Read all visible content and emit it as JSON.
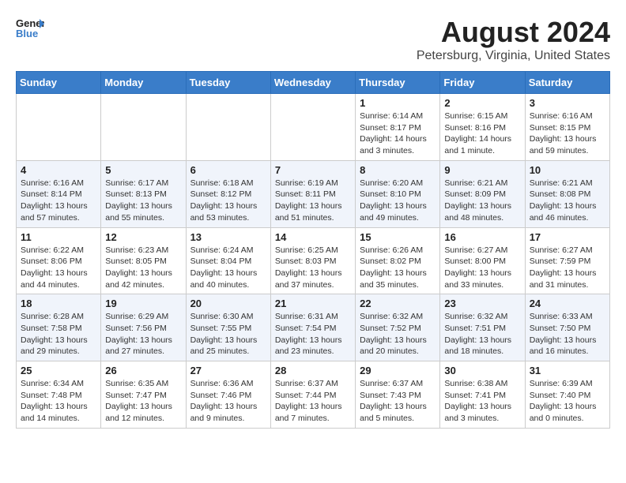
{
  "header": {
    "logo_line1": "General",
    "logo_line2": "Blue",
    "month_title": "August 2024",
    "location": "Petersburg, Virginia, United States"
  },
  "weekdays": [
    "Sunday",
    "Monday",
    "Tuesday",
    "Wednesday",
    "Thursday",
    "Friday",
    "Saturday"
  ],
  "weeks": [
    [
      {
        "day": "",
        "detail": ""
      },
      {
        "day": "",
        "detail": ""
      },
      {
        "day": "",
        "detail": ""
      },
      {
        "day": "",
        "detail": ""
      },
      {
        "day": "1",
        "detail": "Sunrise: 6:14 AM\nSunset: 8:17 PM\nDaylight: 14 hours\nand 3 minutes."
      },
      {
        "day": "2",
        "detail": "Sunrise: 6:15 AM\nSunset: 8:16 PM\nDaylight: 14 hours\nand 1 minute."
      },
      {
        "day": "3",
        "detail": "Sunrise: 6:16 AM\nSunset: 8:15 PM\nDaylight: 13 hours\nand 59 minutes."
      }
    ],
    [
      {
        "day": "4",
        "detail": "Sunrise: 6:16 AM\nSunset: 8:14 PM\nDaylight: 13 hours\nand 57 minutes."
      },
      {
        "day": "5",
        "detail": "Sunrise: 6:17 AM\nSunset: 8:13 PM\nDaylight: 13 hours\nand 55 minutes."
      },
      {
        "day": "6",
        "detail": "Sunrise: 6:18 AM\nSunset: 8:12 PM\nDaylight: 13 hours\nand 53 minutes."
      },
      {
        "day": "7",
        "detail": "Sunrise: 6:19 AM\nSunset: 8:11 PM\nDaylight: 13 hours\nand 51 minutes."
      },
      {
        "day": "8",
        "detail": "Sunrise: 6:20 AM\nSunset: 8:10 PM\nDaylight: 13 hours\nand 49 minutes."
      },
      {
        "day": "9",
        "detail": "Sunrise: 6:21 AM\nSunset: 8:09 PM\nDaylight: 13 hours\nand 48 minutes."
      },
      {
        "day": "10",
        "detail": "Sunrise: 6:21 AM\nSunset: 8:08 PM\nDaylight: 13 hours\nand 46 minutes."
      }
    ],
    [
      {
        "day": "11",
        "detail": "Sunrise: 6:22 AM\nSunset: 8:06 PM\nDaylight: 13 hours\nand 44 minutes."
      },
      {
        "day": "12",
        "detail": "Sunrise: 6:23 AM\nSunset: 8:05 PM\nDaylight: 13 hours\nand 42 minutes."
      },
      {
        "day": "13",
        "detail": "Sunrise: 6:24 AM\nSunset: 8:04 PM\nDaylight: 13 hours\nand 40 minutes."
      },
      {
        "day": "14",
        "detail": "Sunrise: 6:25 AM\nSunset: 8:03 PM\nDaylight: 13 hours\nand 37 minutes."
      },
      {
        "day": "15",
        "detail": "Sunrise: 6:26 AM\nSunset: 8:02 PM\nDaylight: 13 hours\nand 35 minutes."
      },
      {
        "day": "16",
        "detail": "Sunrise: 6:27 AM\nSunset: 8:00 PM\nDaylight: 13 hours\nand 33 minutes."
      },
      {
        "day": "17",
        "detail": "Sunrise: 6:27 AM\nSunset: 7:59 PM\nDaylight: 13 hours\nand 31 minutes."
      }
    ],
    [
      {
        "day": "18",
        "detail": "Sunrise: 6:28 AM\nSunset: 7:58 PM\nDaylight: 13 hours\nand 29 minutes."
      },
      {
        "day": "19",
        "detail": "Sunrise: 6:29 AM\nSunset: 7:56 PM\nDaylight: 13 hours\nand 27 minutes."
      },
      {
        "day": "20",
        "detail": "Sunrise: 6:30 AM\nSunset: 7:55 PM\nDaylight: 13 hours\nand 25 minutes."
      },
      {
        "day": "21",
        "detail": "Sunrise: 6:31 AM\nSunset: 7:54 PM\nDaylight: 13 hours\nand 23 minutes."
      },
      {
        "day": "22",
        "detail": "Sunrise: 6:32 AM\nSunset: 7:52 PM\nDaylight: 13 hours\nand 20 minutes."
      },
      {
        "day": "23",
        "detail": "Sunrise: 6:32 AM\nSunset: 7:51 PM\nDaylight: 13 hours\nand 18 minutes."
      },
      {
        "day": "24",
        "detail": "Sunrise: 6:33 AM\nSunset: 7:50 PM\nDaylight: 13 hours\nand 16 minutes."
      }
    ],
    [
      {
        "day": "25",
        "detail": "Sunrise: 6:34 AM\nSunset: 7:48 PM\nDaylight: 13 hours\nand 14 minutes."
      },
      {
        "day": "26",
        "detail": "Sunrise: 6:35 AM\nSunset: 7:47 PM\nDaylight: 13 hours\nand 12 minutes."
      },
      {
        "day": "27",
        "detail": "Sunrise: 6:36 AM\nSunset: 7:46 PM\nDaylight: 13 hours\nand 9 minutes."
      },
      {
        "day": "28",
        "detail": "Sunrise: 6:37 AM\nSunset: 7:44 PM\nDaylight: 13 hours\nand 7 minutes."
      },
      {
        "day": "29",
        "detail": "Sunrise: 6:37 AM\nSunset: 7:43 PM\nDaylight: 13 hours\nand 5 minutes."
      },
      {
        "day": "30",
        "detail": "Sunrise: 6:38 AM\nSunset: 7:41 PM\nDaylight: 13 hours\nand 3 minutes."
      },
      {
        "day": "31",
        "detail": "Sunrise: 6:39 AM\nSunset: 7:40 PM\nDaylight: 13 hours\nand 0 minutes."
      }
    ]
  ]
}
